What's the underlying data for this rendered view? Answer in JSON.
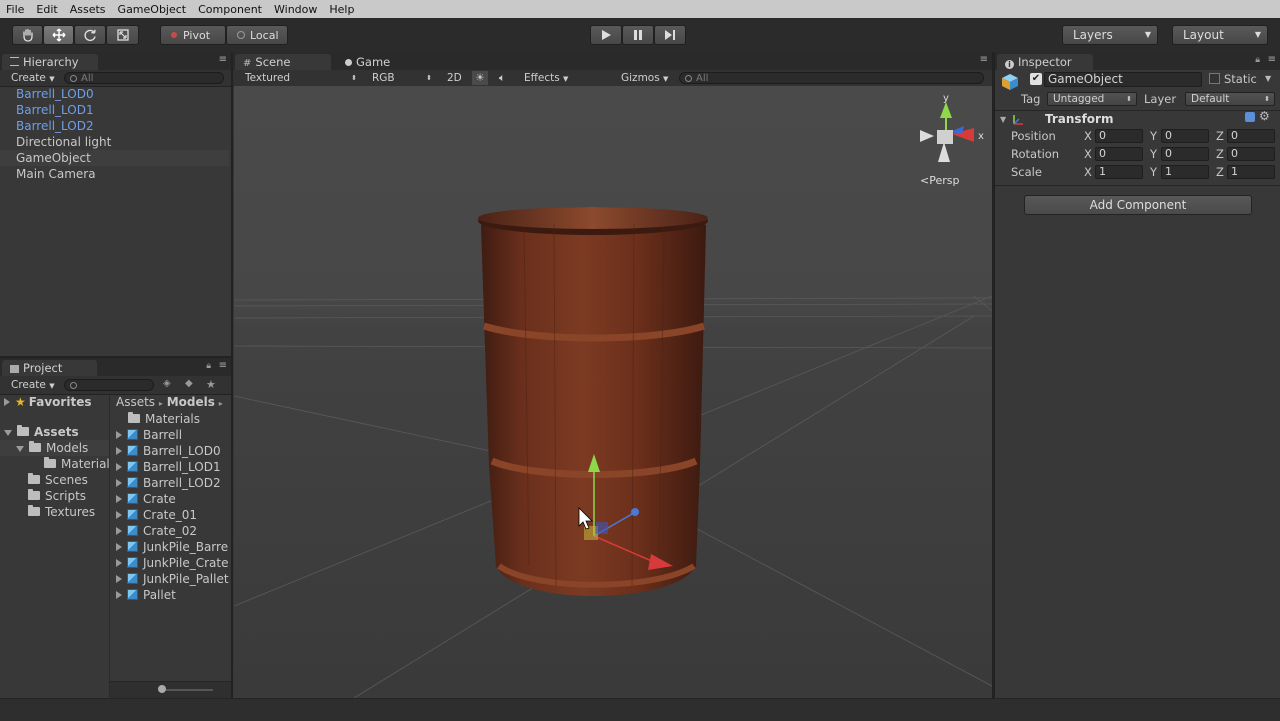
{
  "menu": [
    "File",
    "Edit",
    "Assets",
    "GameObject",
    "Component",
    "Window",
    "Help"
  ],
  "toolbar": {
    "pivot_label": "Pivot",
    "local_label": "Local",
    "layers_label": "Layers",
    "layout_label": "Layout"
  },
  "hierarchy": {
    "tab_label": "Hierarchy",
    "create_label": "Create",
    "search_placeholder": "All",
    "items": [
      {
        "label": "Barrell_LOD0",
        "prefab": true
      },
      {
        "label": "Barrell_LOD1",
        "prefab": true
      },
      {
        "label": "Barrell_LOD2",
        "prefab": true
      },
      {
        "label": "Directional light",
        "prefab": false
      },
      {
        "label": "GameObject",
        "prefab": false,
        "selected": true
      },
      {
        "label": "Main Camera",
        "prefab": false
      }
    ]
  },
  "scene": {
    "tab_scene": "Scene",
    "tab_game": "Game",
    "shading_mode": "Textured",
    "render_mode": "RGB",
    "mode_2d": "2D",
    "effects_label": "Effects",
    "gizmos_label": "Gizmos",
    "search_placeholder": "All",
    "gizmo_y": "y",
    "gizmo_x": "x",
    "persp_label": "Persp"
  },
  "project": {
    "tab_label": "Project",
    "create_label": "Create",
    "favorites_label": "Favorites",
    "tree": {
      "assets_label": "Assets",
      "models_label": "Models",
      "materials_label": "Materials",
      "scenes_label": "Scenes",
      "scripts_label": "Scripts",
      "textures_label": "Textures"
    },
    "breadcrumb": {
      "root": "Assets",
      "current": "Models"
    },
    "files": [
      {
        "label": "Materials",
        "kind": "folder"
      },
      {
        "label": "Barrell",
        "kind": "model"
      },
      {
        "label": "Barrell_LOD0",
        "kind": "model"
      },
      {
        "label": "Barrell_LOD1",
        "kind": "model"
      },
      {
        "label": "Barrell_LOD2",
        "kind": "model"
      },
      {
        "label": "Crate",
        "kind": "model"
      },
      {
        "label": "Crate_01",
        "kind": "model"
      },
      {
        "label": "Crate_02",
        "kind": "model"
      },
      {
        "label": "JunkPile_Barre",
        "kind": "model"
      },
      {
        "label": "JunkPile_Crate",
        "kind": "model"
      },
      {
        "label": "JunkPile_Pallet",
        "kind": "model"
      },
      {
        "label": "Pallet",
        "kind": "model"
      }
    ]
  },
  "inspector": {
    "tab_label": "Inspector",
    "object_name": "GameObject",
    "static_label": "Static",
    "tag_label": "Tag",
    "tag_value": "Untagged",
    "layer_label": "Layer",
    "layer_value": "Default",
    "component_title": "Transform",
    "rows": [
      {
        "label": "Position",
        "x": "0",
        "y": "0",
        "z": "0"
      },
      {
        "label": "Rotation",
        "x": "0",
        "y": "0",
        "z": "0"
      },
      {
        "label": "Scale",
        "x": "1",
        "y": "1",
        "z": "1"
      }
    ],
    "axis_x": "X",
    "axis_y": "Y",
    "axis_z": "Z",
    "add_component_label": "Add Component"
  }
}
